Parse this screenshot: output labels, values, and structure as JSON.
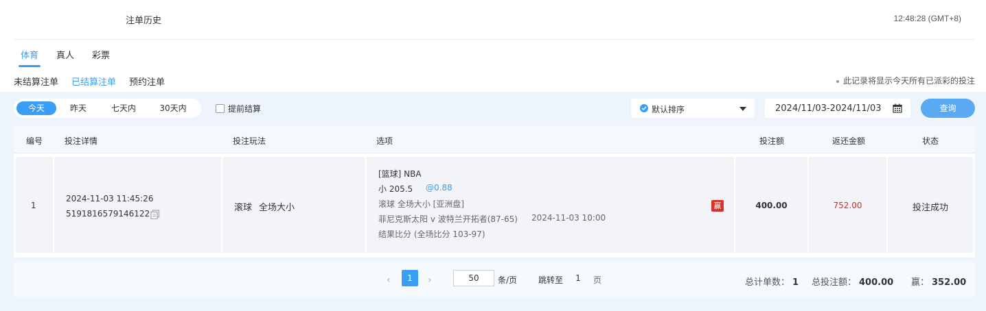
{
  "header": {
    "title": "注单历史",
    "clock": "12:48:28 (GMT+8)"
  },
  "category_tabs": [
    "体育",
    "真人",
    "彩票"
  ],
  "status_tabs": [
    "未结算注单",
    "已结算注单",
    "预约注单"
  ],
  "notice": "此记录将显示今天所有已派彩的投注",
  "filters": {
    "quick_ranges": [
      "今天",
      "昨天",
      "七天内",
      "30天内"
    ],
    "early_settle_label": "提前结算",
    "sort_label": "默认排序",
    "date_range": "2024/11/03-2024/11/03",
    "query_label": "查询"
  },
  "table": {
    "columns": [
      "编号",
      "投注详情",
      "投注玩法",
      "选项",
      "投注额",
      "返还金额",
      "状态"
    ],
    "rows": [
      {
        "index": "1",
        "datetime": "2024-11-03 11:45:26",
        "bet_id": "5191816579146122",
        "play_type": "滚球",
        "play_market": "全场大小",
        "option_sport": "[篮球] NBA",
        "option_pick": "小 205.5",
        "option_odds": "@0.88",
        "option_market": "滚球  全场大小 [亚洲盘]",
        "option_match": "菲尼克斯太阳 v 波特兰开拓者(87-65)",
        "option_match_time": "2024-11-03 10:00",
        "option_result": "结果比分 (全场比分 103-97)",
        "result_badge": "赢",
        "stake": "400.00",
        "return_amount": "752.00",
        "status": "投注成功"
      }
    ]
  },
  "pagination": {
    "current_page": "1",
    "page_size": "50",
    "page_size_unit": "条/页",
    "jump_label": "跳转至",
    "jump_value": "1",
    "page_unit": "页"
  },
  "summary": {
    "count_label": "总计单数：",
    "count_value": "1",
    "stake_label": "总投注额：",
    "stake_value": "400.00",
    "win_label": "赢：",
    "win_value": "352.00"
  },
  "colors": {
    "accent": "#3a9ef5",
    "win_red": "#d9322c",
    "return_red": "#c9302c",
    "panel_bg": "#eef4fc"
  },
  "icons": [
    "copy-icon",
    "calendar-icon",
    "caret-down-icon",
    "check-circle-icon",
    "chevron-left-icon",
    "chevron-right-icon"
  ]
}
